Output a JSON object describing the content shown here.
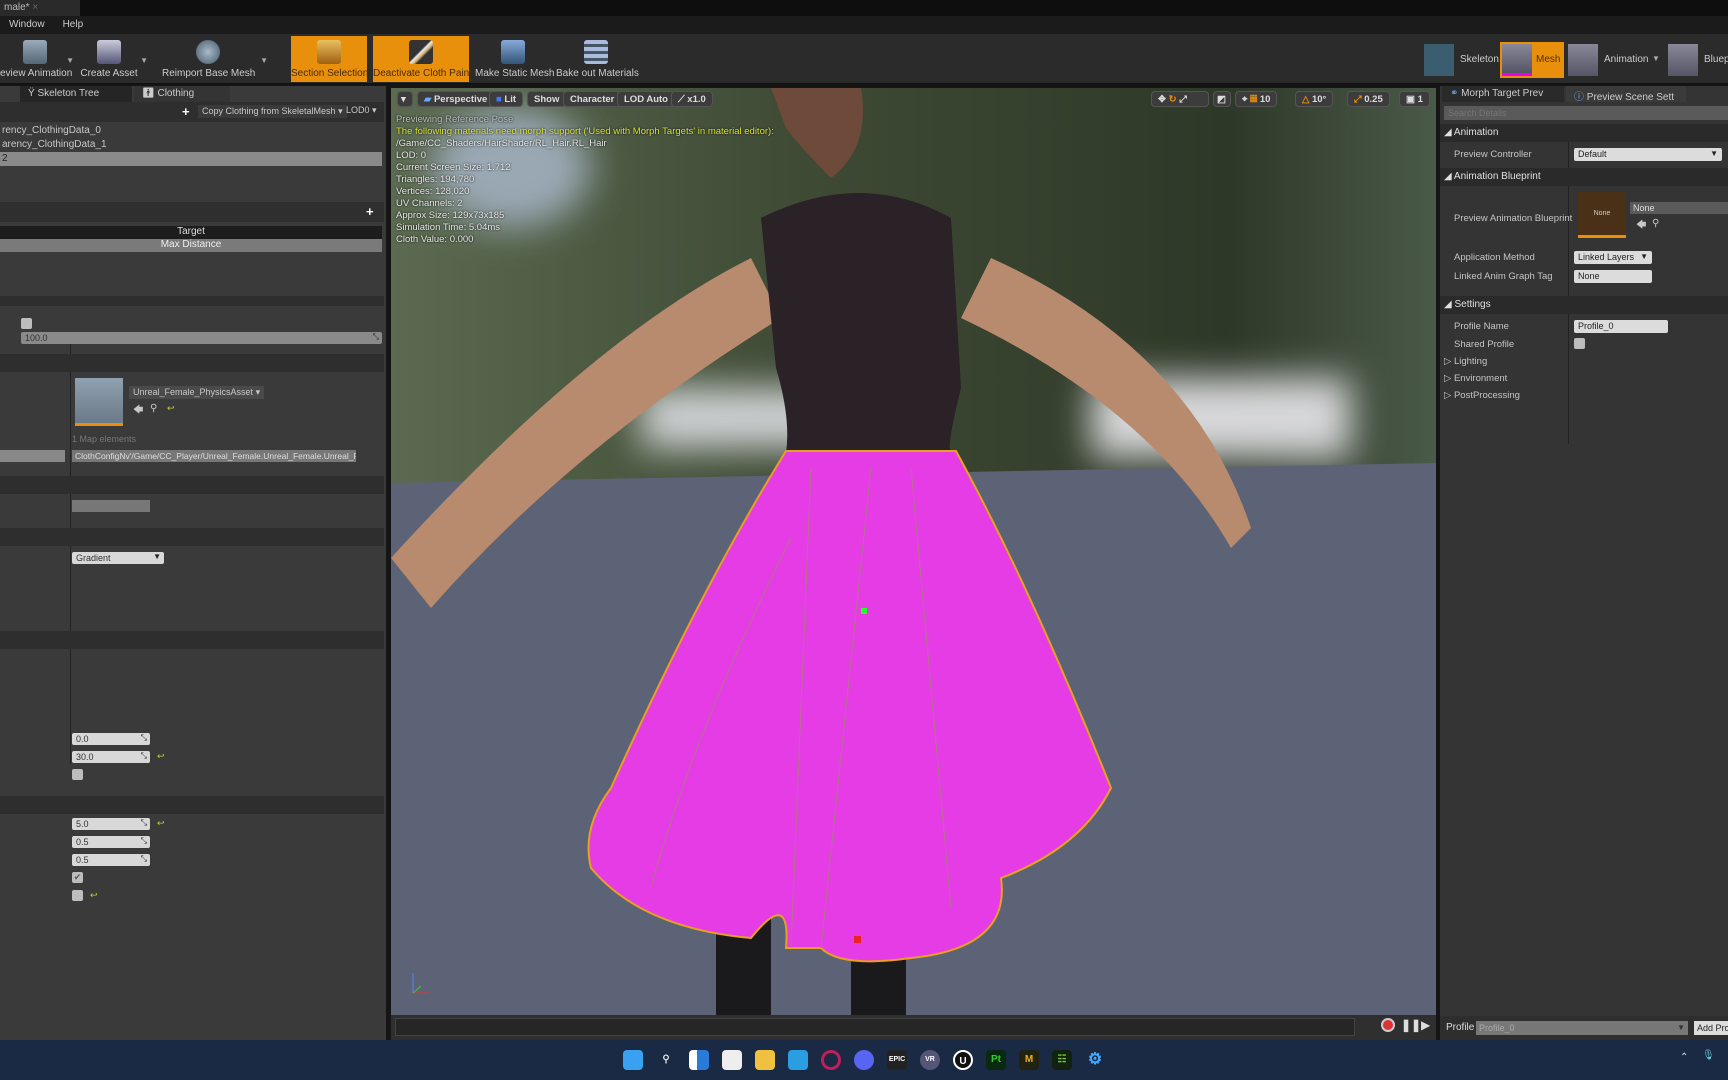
{
  "window": {
    "doc_tab": "male*"
  },
  "menu": [
    "Window",
    "Help"
  ],
  "toolbar": {
    "items": [
      {
        "label": "eview Animation",
        "active": false,
        "dropdown": true
      },
      {
        "label": "Create Asset",
        "active": false,
        "dropdown": true
      },
      {
        "label": "Reimport Base Mesh",
        "active": false,
        "dropdown": true
      },
      {
        "label": "Section Selection",
        "active": true
      },
      {
        "label": "Deactivate Cloth Paint",
        "active": true
      },
      {
        "label": "Make Static Mesh",
        "active": false
      },
      {
        "label": "Bake out Materials",
        "active": false
      }
    ],
    "modes": [
      {
        "label": "Skeleton"
      },
      {
        "label": "Mesh",
        "active": true
      },
      {
        "label": "Animation"
      },
      {
        "label": "Bluep"
      }
    ],
    "accent": "#e8900c"
  },
  "left": {
    "tabs": [
      "Skeleton Tree",
      "Clothing"
    ],
    "copy_clothing": "Copy Clothing from SkeletalMesh",
    "lod": "LOD0",
    "clothing_data": [
      "rency_ClothingData_0",
      "arency_ClothingData_1",
      "2"
    ],
    "target_header": "Target",
    "target_value": "Max Distance",
    "value_100": "100.0",
    "physics_asset": "Unreal_Female_PhysicsAsset",
    "map_elements": "1 Map elements",
    "cloth_config": "ClothConfigNv'/Game/CC_Player/Unreal_Female.Unreal_Female.Unreal_Fe",
    "gradient": "Gradient",
    "values_a": [
      "0.0",
      "30.0"
    ],
    "values_b": [
      "5.0",
      "0.5",
      "0.5"
    ]
  },
  "viewport": {
    "buttons": [
      "Perspective",
      "Lit",
      "Show",
      "Character",
      "LOD Auto",
      "x1.0"
    ],
    "right_tools": {
      "grid": "10",
      "angle": "10°",
      "scale": "0.25",
      "speed": "1"
    },
    "stats": {
      "pose": "Previewing Reference Pose",
      "warning": "The following materials need morph support ('Used with Morph Targets' in material editor):",
      "material": "/Game/CC_Shaders/HairShader/RL_Hair.RL_Hair",
      "lines": [
        "LOD: 0",
        "Current Screen Size: 1.712",
        "Triangles: 194,780",
        "Vertices: 128,020",
        "UV Channels: 2",
        "Approx Size: 129x73x185",
        "Simulation Time: 5.04ms",
        "Cloth Value: 0.000"
      ]
    },
    "cloth_color": "#e63ce6"
  },
  "right": {
    "tabs": [
      "Morph Target Prev",
      "Preview Scene Sett"
    ],
    "search_placeholder": "Search Details",
    "sections": {
      "animation": "Animation",
      "anim_bp": "Animation Blueprint",
      "settings": "Settings"
    },
    "preview_controller": {
      "label": "Preview Controller",
      "value": "Default"
    },
    "preview_anim_bp": {
      "label": "Preview Animation Blueprint",
      "thumb": "None",
      "value": "None"
    },
    "application_method": {
      "label": "Application Method",
      "value": "Linked Layers"
    },
    "linked_tag": {
      "label": "Linked Anim Graph Tag",
      "value": "None"
    },
    "profile_name": {
      "label": "Profile Name",
      "value": "Profile_0"
    },
    "shared_profile": {
      "label": "Shared Profile"
    },
    "collapsed": [
      "Lighting",
      "Environment",
      "PostProcessing"
    ],
    "profile_bar": {
      "label": "Profile",
      "value": "Profile_0",
      "add": "Add Pro"
    }
  },
  "taskbar": {
    "icons": [
      "windows-start",
      "search",
      "task-view",
      "snipping-tool",
      "file-explorer",
      "mail",
      "opera",
      "discord",
      "epic-games",
      "vr",
      "unreal-engine",
      "substance-painter",
      "marmoset",
      "nvidia-broadcast",
      "settings"
    ]
  }
}
